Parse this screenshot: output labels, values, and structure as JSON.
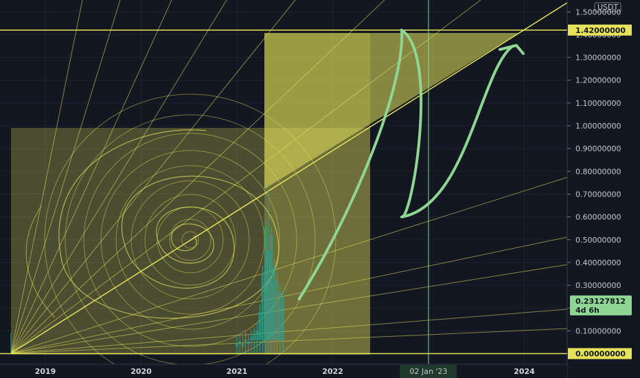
{
  "chart_data": {
    "type": "candlestick",
    "title": "",
    "currency": "USDT",
    "x_axis_ticks": [
      "2019",
      "2020",
      "2021",
      "2022",
      "2023",
      "2024"
    ],
    "cursor_date_label": "02 Jan '23",
    "y_axis_ticks": [
      "0.00000000",
      "0.10000000",
      "0.20000000",
      "0.30000000",
      "0.40000000",
      "0.50000000",
      "0.60000000",
      "0.70000000",
      "0.80000000",
      "0.90000000",
      "1.00000000",
      "1.10000000",
      "1.20000000",
      "1.30000000",
      "1.40000000",
      "1.50000000"
    ],
    "ylim": [
      0,
      1.55
    ],
    "price_levels": [
      {
        "label": "1.42000000",
        "value": 1.42
      },
      {
        "label": "0.00000000",
        "value": 0.0
      }
    ],
    "last_price": {
      "label": "0.23127812",
      "countdown": "4d 6h",
      "value": 0.2313
    },
    "candles": [
      {
        "t": 2021.0,
        "close": 0.04
      },
      {
        "t": 2021.03,
        "close": 0.05
      },
      {
        "t": 2021.06,
        "close": 0.04
      },
      {
        "t": 2021.09,
        "close": 0.06
      },
      {
        "t": 2021.12,
        "close": 0.05
      },
      {
        "t": 2021.15,
        "close": 0.07
      },
      {
        "t": 2021.18,
        "close": 0.08
      },
      {
        "t": 2021.21,
        "close": 0.1
      },
      {
        "t": 2021.24,
        "close": 0.18
      },
      {
        "t": 2021.27,
        "close": 0.35
      },
      {
        "t": 2021.3,
        "close": 0.55
      },
      {
        "t": 2021.33,
        "close": 0.45
      },
      {
        "t": 2021.36,
        "close": 0.52
      },
      {
        "t": 2021.39,
        "close": 0.38
      },
      {
        "t": 2021.42,
        "close": 0.32
      },
      {
        "t": 2021.45,
        "close": 0.27
      },
      {
        "t": 2021.48,
        "close": 0.24
      }
    ],
    "projection": [
      {
        "t": 2021.65,
        "y": 0.24
      },
      {
        "t": 2022.72,
        "y": 1.42
      },
      {
        "t": 2022.72,
        "y": 0.6
      },
      {
        "t": 2023.88,
        "y": 1.35
      }
    ],
    "colors": {
      "background": "#131722",
      "drawing": "#e6e35b",
      "projection": "#8fd694",
      "cursor": "#8fd694",
      "candle": "#26a69a"
    }
  }
}
